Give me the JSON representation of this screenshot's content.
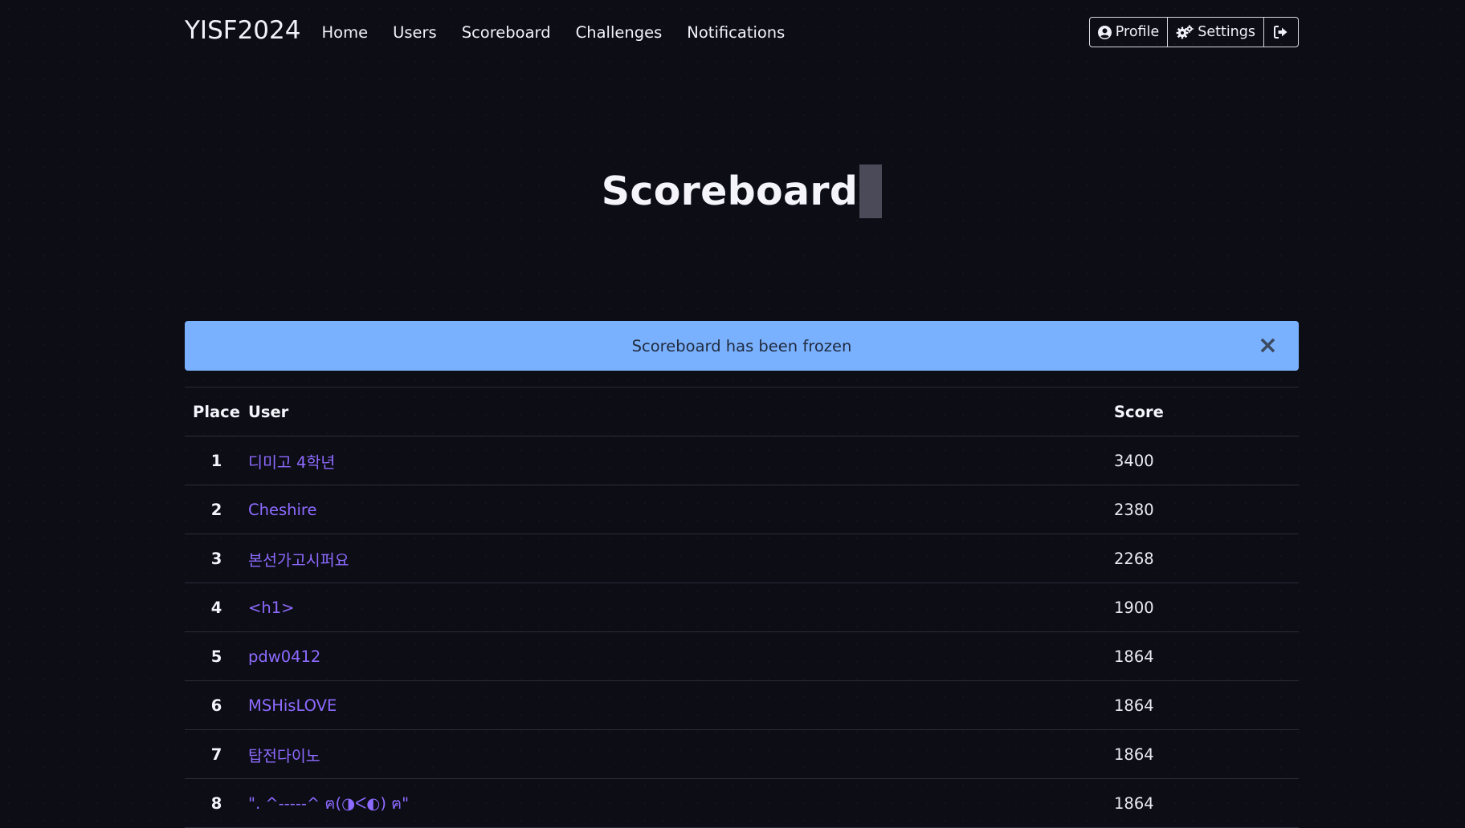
{
  "navbar": {
    "brand": "YISF2024",
    "links": [
      "Home",
      "Users",
      "Scoreboard",
      "Challenges",
      "Notifications"
    ],
    "profile_label": "Profile",
    "settings_label": "Settings"
  },
  "page": {
    "title": "Scoreboard"
  },
  "alert": {
    "message": "Scoreboard has been frozen",
    "close": "×"
  },
  "table": {
    "headers": {
      "place": "Place",
      "user": "User",
      "score": "Score"
    },
    "rows": [
      {
        "place": "1",
        "user": "디미고 4학년",
        "score": "3400"
      },
      {
        "place": "2",
        "user": "Cheshire",
        "score": "2380"
      },
      {
        "place": "3",
        "user": "본선가고시퍼요",
        "score": "2268"
      },
      {
        "place": "4",
        "user": "<h1>",
        "score": "1900"
      },
      {
        "place": "5",
        "user": "pdw0412",
        "score": "1864"
      },
      {
        "place": "6",
        "user": "MSHisLOVE",
        "score": "1864"
      },
      {
        "place": "7",
        "user": "탑전다이노",
        "score": "1864"
      },
      {
        "place": "8",
        "user": "\". ^-----^ ฅ(◑ᐸ◐) ฅ\"",
        "score": "1864"
      }
    ]
  },
  "colors": {
    "background": "#0d0d16",
    "alert": "#7ab1ff",
    "link": "#8d6bff"
  }
}
